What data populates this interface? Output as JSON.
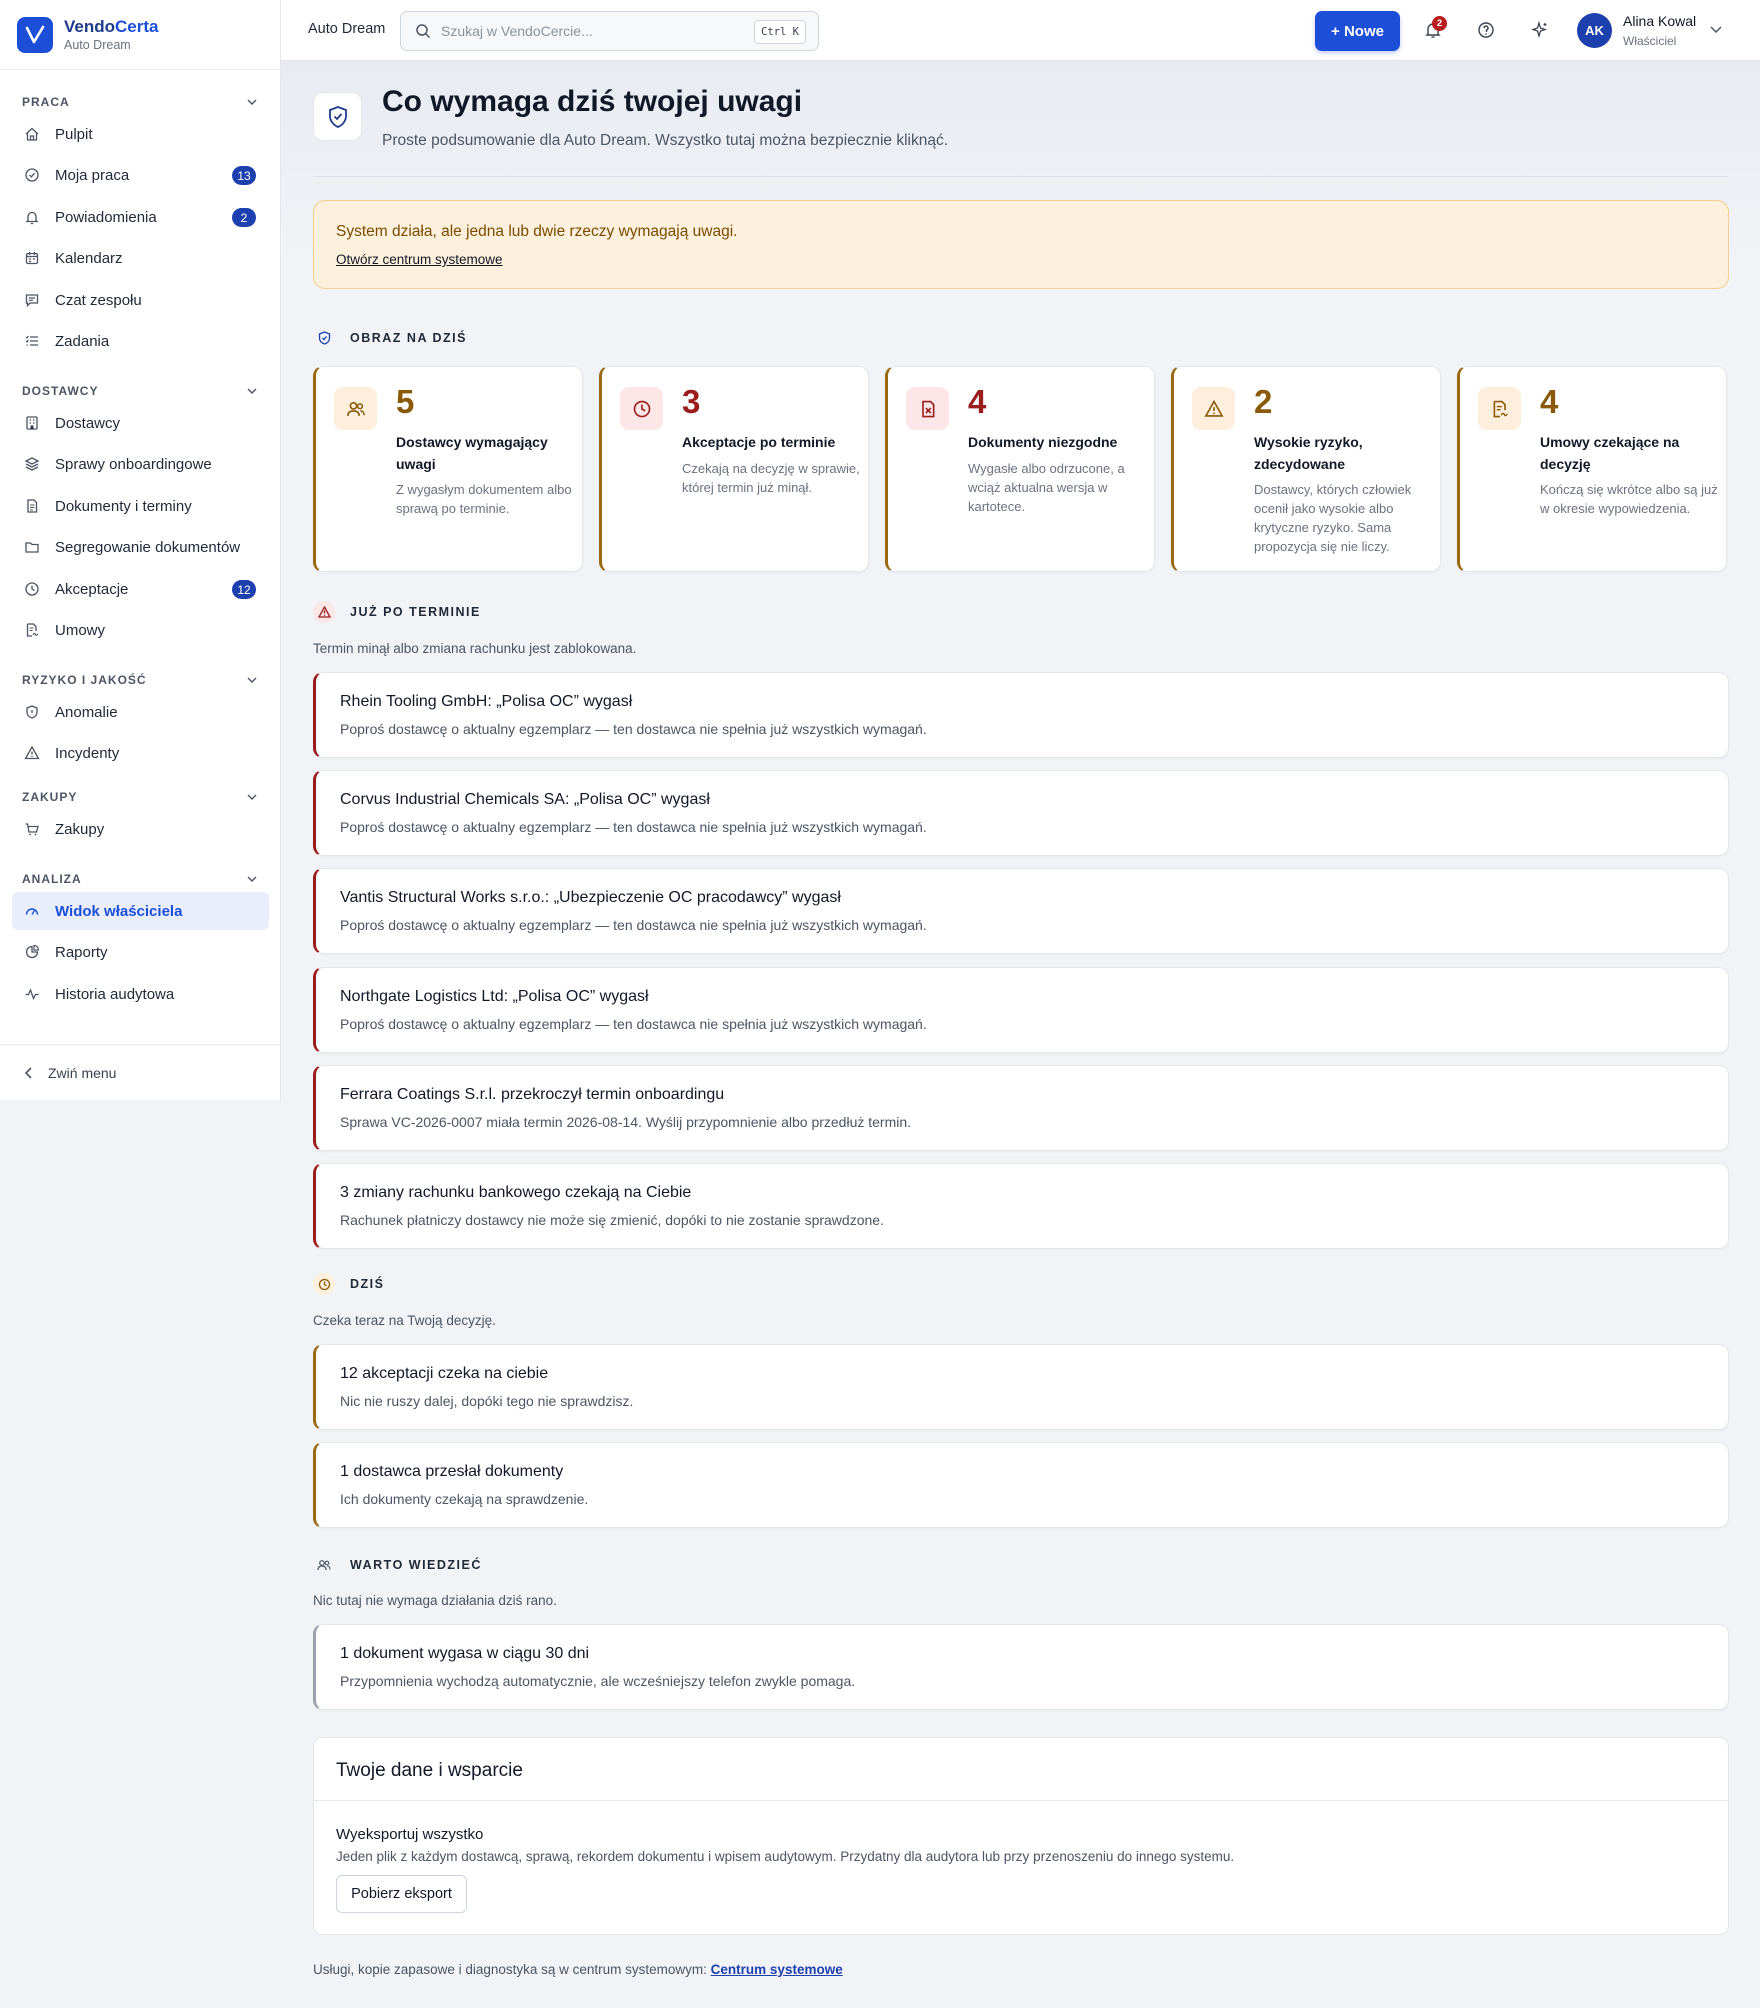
{
  "brand": {
    "name_a": "Vendo",
    "name_b": "Certa",
    "org": "Auto Dream"
  },
  "sidebar": {
    "sections": [
      {
        "label": "PRACA",
        "items": [
          {
            "label": "Pulpit",
            "icon": "home-icon"
          },
          {
            "label": "Moja praca",
            "icon": "check-circle-icon",
            "badge": "13"
          },
          {
            "label": "Powiadomienia",
            "icon": "bell-icon",
            "badge": "2"
          },
          {
            "label": "Kalendarz",
            "icon": "calendar-icon"
          },
          {
            "label": "Czat zespołu",
            "icon": "chat-icon"
          },
          {
            "label": "Zadania",
            "icon": "list-icon"
          }
        ]
      },
      {
        "label": "DOSTAWCY",
        "items": [
          {
            "label": "Dostawcy",
            "icon": "building-icon"
          },
          {
            "label": "Sprawy onboardingowe",
            "icon": "layers-icon"
          },
          {
            "label": "Dokumenty i terminy",
            "icon": "file-icon"
          },
          {
            "label": "Segregowanie dokumentów",
            "icon": "folder-icon"
          },
          {
            "label": "Akceptacje",
            "icon": "clock-icon",
            "badge": "12"
          },
          {
            "label": "Umowy",
            "icon": "contract-icon"
          }
        ]
      },
      {
        "label": "RYZYKO I JAKOŚĆ",
        "items": [
          {
            "label": "Anomalie",
            "icon": "shield-icon"
          },
          {
            "label": "Incydenty",
            "icon": "warning-icon"
          }
        ]
      },
      {
        "label": "ZAKUPY",
        "items": [
          {
            "label": "Zakupy",
            "icon": "cart-icon"
          }
        ]
      },
      {
        "label": "ANALIZA",
        "items": [
          {
            "label": "Widok właściciela",
            "icon": "gauge-icon",
            "active": true
          },
          {
            "label": "Raporty",
            "icon": "pie-icon"
          },
          {
            "label": "Historia audytowa",
            "icon": "activity-icon"
          }
        ]
      }
    ],
    "collapse_label": "Zwiń menu"
  },
  "topbar": {
    "org": "Auto Dream",
    "search_placeholder": "Szukaj w VendoCercie...",
    "shortcut": "Ctrl K",
    "new_label": "+ Nowe",
    "notif_count": "2",
    "user": {
      "initials": "AK",
      "name": "Alina Kowal",
      "role": "Właściciel"
    }
  },
  "page": {
    "title": "Co wymaga dziś twojej uwagi",
    "subtitle": "Proste podsumowanie dla Auto Dream. Wszystko tutaj można bezpiecznie kliknąć."
  },
  "alert": {
    "text": "System działa, ale jedna lub dwie rzeczy wymagają uwagi.",
    "link": "Otwórz centrum systemowe"
  },
  "overview": {
    "title": "OBRAZ NA DZIŚ",
    "cards": [
      {
        "value": "5",
        "title": "Dostawcy wymagający uwagi",
        "desc": "Z wygasłym dokumentem albo sprawą po terminie.",
        "icon": "users-icon",
        "color": "#8a5a0a",
        "bg": "#fdefdc"
      },
      {
        "value": "3",
        "title": "Akceptacje po terminie",
        "desc": "Czekają na decyzję w sprawie, której termin już minął.",
        "icon": "clock-icon",
        "color": "#9b1c1c",
        "bg": "#fde6e6"
      },
      {
        "value": "4",
        "title": "Dokumenty niezgodne",
        "desc": "Wygasłe albo odrzucone, a wciąż aktualna wersja w kartotece.",
        "icon": "file-x-icon",
        "color": "#9b1c1c",
        "bg": "#fde6e6"
      },
      {
        "value": "2",
        "title": "Wysokie ryzyko, zdecydowane",
        "desc": "Dostawcy, których człowiek ocenił jako wysokie albo krytyczne ryzyko. Sama propozycja się nie liczy.",
        "icon": "warning-icon",
        "color": "#8a5a0a",
        "bg": "#fdefdc"
      },
      {
        "value": "4",
        "title": "Umowy czekające na decyzję",
        "desc": "Kończą się wkrótce albo są już w okresie wypowiedzenia.",
        "icon": "contract-icon",
        "color": "#8a5a0a",
        "bg": "#fdefdc"
      }
    ]
  },
  "overdue": {
    "title": "JUŻ PO TERMINIE",
    "desc": "Termin minął albo zmiana rachunku jest zablokowana.",
    "rows": [
      {
        "title": "Rhein Tooling GmbH: „Polisa OC” wygasł",
        "desc": "Poproś dostawcę o aktualny egzemplarz — ten dostawca nie spełnia już wszystkich wymagań."
      },
      {
        "title": "Corvus Industrial Chemicals SA: „Polisa OC” wygasł",
        "desc": "Poproś dostawcę o aktualny egzemplarz — ten dostawca nie spełnia już wszystkich wymagań."
      },
      {
        "title": "Vantis Structural Works s.r.o.: „Ubezpieczenie OC pracodawcy” wygasł",
        "desc": "Poproś dostawcę o aktualny egzemplarz — ten dostawca nie spełnia już wszystkich wymagań."
      },
      {
        "title": "Northgate Logistics Ltd: „Polisa OC” wygasł",
        "desc": "Poproś dostawcę o aktualny egzemplarz — ten dostawca nie spełnia już wszystkich wymagań."
      },
      {
        "title": "Ferrara Coatings S.r.l. przekroczył termin onboardingu",
        "desc": "Sprawa VC-2026-0007 miała termin 2026-08-14. Wyślij przypomnienie albo przedłuż termin."
      },
      {
        "title": "3 zmiany rachunku bankowego czekają na Ciebie",
        "desc": "Rachunek płatniczy dostawcy nie może się zmienić, dopóki to nie zostanie sprawdzone."
      }
    ]
  },
  "today": {
    "title": "DZIŚ",
    "desc": "Czeka teraz na Twoją decyzję.",
    "rows": [
      {
        "title": "12 akceptacji czeka na ciebie",
        "desc": "Nic nie ruszy dalej, dopóki tego nie sprawdzisz."
      },
      {
        "title": "1 dostawca przesłał dokumenty",
        "desc": "Ich dokumenty czekają na sprawdzenie."
      }
    ]
  },
  "fyi": {
    "title": "WARTO WIEDZIEĆ",
    "desc": "Nic tutaj nie wymaga działania dziś rano.",
    "rows": [
      {
        "title": "1 dokument wygasa w ciągu 30 dni",
        "desc": "Przypomnienia wychodzą automatycznie, ale wcześniejszy telefon zwykle pomaga."
      }
    ]
  },
  "data_card": {
    "title": "Twoje dane i wsparcie",
    "export_title": "Wyeksportuj wszystko",
    "export_desc": "Jeden plik z każdym dostawcą, sprawą, rekordem dokumentu i wpisem audytowym. Przydatny dla audytora lub przy przenoszeniu do innego systemu.",
    "button": "Pobierz eksport"
  },
  "footer": {
    "text": "Usługi, kopie zapasowe i diagnostyka są w centrum systemowym: ",
    "link": "Centrum systemowe"
  }
}
